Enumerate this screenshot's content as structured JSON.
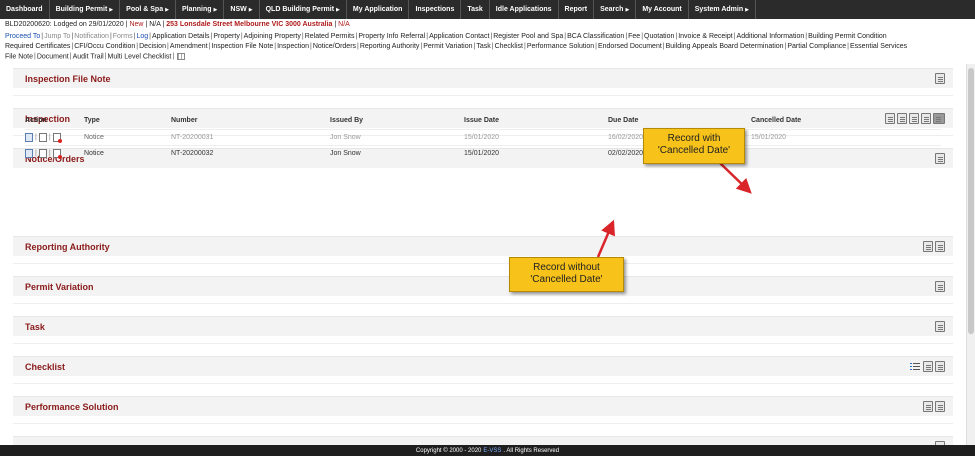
{
  "topnav": [
    {
      "label": "Dashboard",
      "caret": false
    },
    {
      "label": "Building Permit",
      "caret": true
    },
    {
      "label": "Pool & Spa",
      "caret": true
    },
    {
      "label": "Planning",
      "caret": true
    },
    {
      "label": "NSW",
      "caret": true
    },
    {
      "label": "QLD Building Permit",
      "caret": true
    },
    {
      "label": "My Application",
      "caret": false
    },
    {
      "label": "Inspections",
      "caret": false
    },
    {
      "label": "Task",
      "caret": false
    },
    {
      "label": "Idle Applications",
      "caret": false
    },
    {
      "label": "Report",
      "caret": false
    },
    {
      "label": "Search",
      "caret": true
    },
    {
      "label": "My Account",
      "caret": false
    },
    {
      "label": "System Admin",
      "caret": true
    }
  ],
  "appline": {
    "ref": "BLD20200620: Lodged on 29/01/2020",
    "status": "New",
    "na1": "N/A",
    "address": "253 Lonsdale Street Melbourne VIC 3000 Australia",
    "na2": "N/A"
  },
  "links_row1": [
    {
      "label": "Proceed To",
      "tone": "blue"
    },
    {
      "label": "Jump To",
      "tone": "grey"
    },
    {
      "label": "Notification",
      "tone": "grey"
    },
    {
      "label": "Forms",
      "tone": "grey"
    },
    {
      "label": "Log",
      "tone": "blue"
    },
    {
      "label": "Application Details",
      "tone": ""
    },
    {
      "label": "Property",
      "tone": ""
    },
    {
      "label": "Adjoining Property",
      "tone": ""
    },
    {
      "label": "Related Permits",
      "tone": ""
    },
    {
      "label": "Property Info Referral",
      "tone": ""
    },
    {
      "label": "Application Contact",
      "tone": ""
    },
    {
      "label": "Register Pool and Spa",
      "tone": ""
    },
    {
      "label": "BCA Classification",
      "tone": ""
    },
    {
      "label": "Fee",
      "tone": ""
    },
    {
      "label": "Quotation",
      "tone": ""
    },
    {
      "label": "Invoice & Receipt",
      "tone": ""
    },
    {
      "label": "Additional Information",
      "tone": ""
    },
    {
      "label": "Building Permit Condition",
      "tone": ""
    }
  ],
  "links_row2": [
    "Required Certificates",
    "CFI/Occu Condition",
    "Decision",
    "Amendment",
    "Inspection File Note",
    "Inspection",
    "Notice/Orders",
    "Reporting Authority",
    "Permit Variation",
    "Task",
    "Checklist",
    "Performance Solution",
    "Endorsed Document",
    "Building Appeals Board Determination",
    "Partial Compliance",
    "Essential Services"
  ],
  "links_row3": [
    "File Note",
    "Document",
    "Audit Trail",
    "Multi Level Checklist"
  ],
  "sections": {
    "inspection_file_note": "Inspection File Note",
    "inspection": "Inspection",
    "notice_orders": "Notice/Orders",
    "reporting_authority": "Reporting Authority",
    "permit_variation": "Permit Variation",
    "task": "Task",
    "checklist": "Checklist",
    "performance_solution": "Performance Solution"
  },
  "notice_table": {
    "headers": [
      "Action",
      "Type",
      "Number",
      "Issued By",
      "Issue Date",
      "Due Date",
      "Cancelled Date"
    ],
    "rows": [
      {
        "type": "Notice",
        "number": "NT-20200031",
        "issued_by": "Jon Snow",
        "issue_date": "15/01/2020",
        "due_date": "16/02/2020",
        "cancelled_date": "15/01/2020"
      },
      {
        "type": "Notice",
        "number": "NT-20200032",
        "issued_by": "Jon Snow",
        "issue_date": "15/01/2020",
        "due_date": "02/02/2020",
        "cancelled_date": ""
      }
    ]
  },
  "callouts": {
    "with": {
      "line1": "Record with",
      "line2": "'Cancelled Date'"
    },
    "without": {
      "line1": "Record without",
      "line2": "'Cancelled Date'"
    }
  },
  "footer": {
    "pre": "Copyright © 2000 - 2020",
    "brand": "E-VSS",
    "post": ". All Rights Reserved"
  },
  "colors": {
    "nav_bg": "#2b2b2b",
    "section_title": "#8b1a1a",
    "callout": "#f7c21a",
    "arrow": "#d9252a"
  }
}
